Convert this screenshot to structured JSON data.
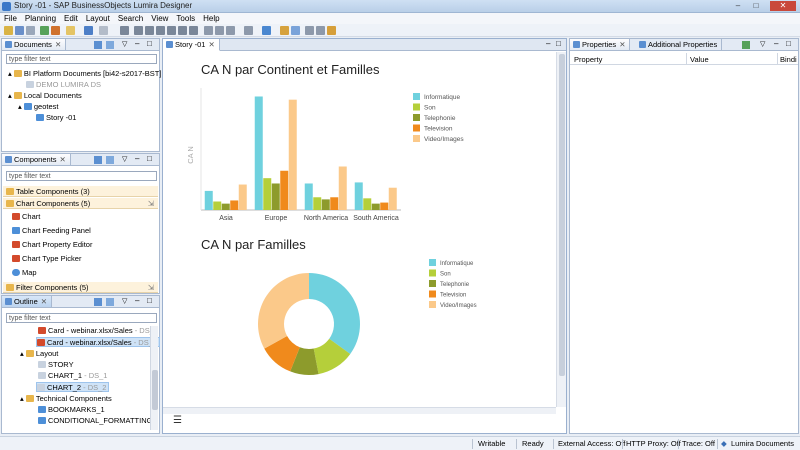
{
  "window": {
    "title": "Story -01 - SAP BusinessObjects Lumira Designer"
  },
  "menu": [
    "File",
    "Planning",
    "Edit",
    "Layout",
    "Search",
    "View",
    "Tools",
    "Help"
  ],
  "documents_panel": {
    "tab": "Documents",
    "filter_placeholder": "type filter text",
    "items": [
      {
        "label": "BI Platform Documents [bi42-s2017-BST]"
      },
      {
        "label": "DEMO LUMIRA DS"
      },
      {
        "label": "Local Documents"
      },
      {
        "label": "geotest"
      },
      {
        "label": "Story -01"
      }
    ]
  },
  "components_panel": {
    "tab": "Components",
    "filter_placeholder": "type filter text",
    "sections": {
      "table": "Table Components (3)",
      "chart": "Chart Components (5)",
      "filter": "Filter Components (5)"
    },
    "chart_items": [
      "Chart",
      "Chart Feeding Panel",
      "Chart Property Editor",
      "Chart Type Picker",
      "Map"
    ]
  },
  "outline_panel": {
    "tab": "Outline",
    "filter_placeholder": "type filter text",
    "items": [
      {
        "label": "Card - webinar.xlsx/Sales",
        "ds": " - DS_1"
      },
      {
        "label": "Card - webinar.xlsx/Sales",
        "ds": " - DS_2"
      },
      {
        "label": "Layout",
        "ds": ""
      },
      {
        "label": "STORY",
        "ds": ""
      },
      {
        "label": "CHART_1",
        "ds": " - DS_1"
      },
      {
        "label": "CHART_2",
        "ds": " - DS_2"
      },
      {
        "label": "Technical Components",
        "ds": ""
      },
      {
        "label": "BOOKMARKS_1",
        "ds": ""
      },
      {
        "label": "CONDITIONAL_FORMATTING_S",
        "ds": ""
      }
    ]
  },
  "editor": {
    "tab": "Story -01"
  },
  "properties_panel": {
    "tabs": [
      "Properties",
      "Additional Properties"
    ],
    "columns": [
      "Property",
      "Value",
      "Bindi"
    ]
  },
  "statusbar": {
    "writable": "Writable",
    "ready": "Ready",
    "external": "External Access: Off",
    "proxy": "HTTP Proxy: Off",
    "trace": "Trace: Off",
    "lumira": "Lumira Documents"
  },
  "colors": {
    "informatique": "#6fd1de",
    "son": "#b5cf3a",
    "telephonie": "#8d9b2c",
    "television": "#f08a1c",
    "video": "#fbc98a"
  },
  "chart_data": [
    {
      "type": "bar",
      "title": "CA N par Continent et Familles",
      "ylabel": "CA N",
      "categories": [
        "Asia",
        "Europe",
        "North America",
        "South America"
      ],
      "series": [
        {
          "name": "Informatique",
          "color": "#6fd1de",
          "values": [
            18,
            107,
            25,
            26
          ]
        },
        {
          "name": "Son",
          "color": "#b5cf3a",
          "values": [
            8,
            30,
            12,
            11
          ]
        },
        {
          "name": "Telephonie",
          "color": "#8d9b2c",
          "values": [
            6,
            25,
            10,
            6
          ]
        },
        {
          "name": "Television",
          "color": "#f08a1c",
          "values": [
            9,
            37,
            12,
            7
          ]
        },
        {
          "name": "Video/Images",
          "color": "#fbc98a",
          "values": [
            24,
            104,
            41,
            21
          ]
        }
      ],
      "legend": "right"
    },
    {
      "type": "pie",
      "title": "CA N par Familles",
      "categories": [
        "Informatique",
        "Son",
        "Telephonie",
        "Television",
        "Video/Images"
      ],
      "values": [
        35,
        12,
        9,
        11,
        33
      ],
      "colors": [
        "#6fd1de",
        "#b5cf3a",
        "#8d9b2c",
        "#f08a1c",
        "#fbc98a"
      ],
      "legend": "right"
    }
  ]
}
